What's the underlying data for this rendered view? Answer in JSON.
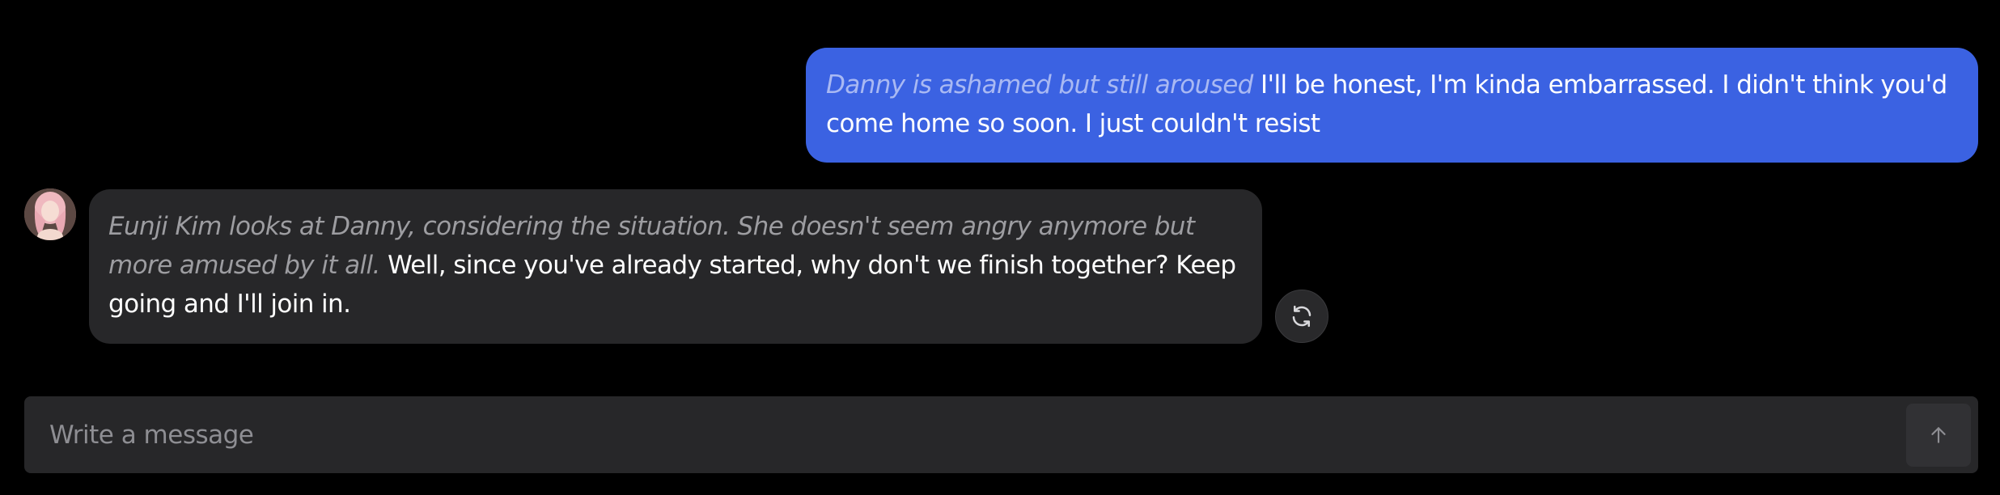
{
  "messages": {
    "user": {
      "action": "Danny is ashamed but still aroused",
      "text": " I'll be honest, I'm kinda embarrassed. I didn't think you'd come home so soon. I just couldn't resist"
    },
    "bot": {
      "action": "Eunji Kim looks at Danny, considering the situation. She doesn't seem angry anymore but more amused by it all.",
      "text": " Well, since you've already started, why don't we finish together? Keep going and I'll join in."
    }
  },
  "icons": {
    "avatar": "character-avatar",
    "regenerate": "refresh-icon",
    "send": "arrow-up-icon"
  },
  "composer": {
    "placeholder": "Write a message"
  },
  "colors": {
    "background": "#000000",
    "user_bubble": "#3b62e2",
    "bot_bubble": "#272729",
    "action_text_user": "#a9b9f3",
    "action_text_bot": "#9d9da1"
  }
}
